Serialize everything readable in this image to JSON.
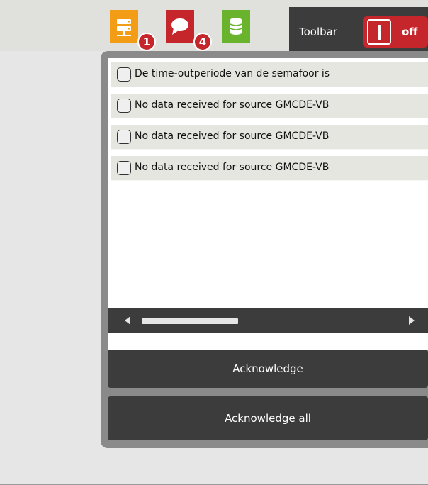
{
  "toolbar": {
    "label": "Toolbar",
    "toggle_state": "off"
  },
  "icons": [
    {
      "name": "server-icon",
      "color": "#f39c16",
      "badge": "1"
    },
    {
      "name": "chat-icon",
      "color": "#c4262c",
      "badge": "4"
    },
    {
      "name": "database-icon",
      "color": "#6ab42d"
    }
  ],
  "alarms": [
    {
      "text": "De time-outperiode van de semafoor is"
    },
    {
      "text": "No data received for source GMCDE-VB"
    },
    {
      "text": "No data received for source GMCDE-VB"
    },
    {
      "text": "No data received for source GMCDE-VB"
    }
  ],
  "buttons": {
    "acknowledge": "Acknowledge",
    "acknowledge_all": "Acknowledge all"
  }
}
